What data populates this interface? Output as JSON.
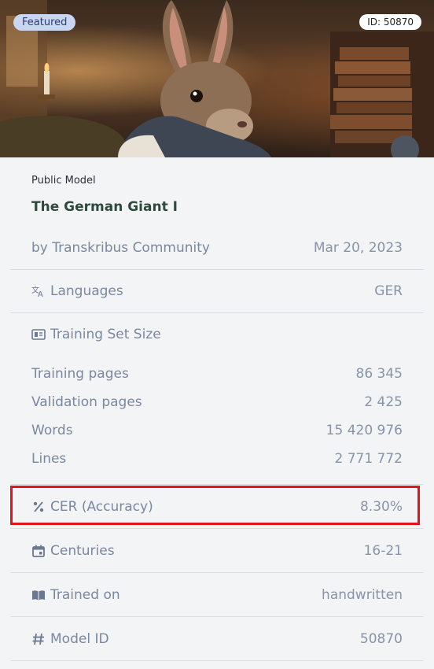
{
  "hero": {
    "featured_badge": "Featured",
    "id_badge": "ID: 50870"
  },
  "model": {
    "kind": "Public Model",
    "title": "The German Giant I",
    "author": "by Transkribus Community",
    "date": "Mar 20, 2023"
  },
  "details": {
    "languages_label": "Languages",
    "languages_value": "GER",
    "training_set_label": "Training Set Size",
    "training_pages_label": "Training pages",
    "training_pages_value": "86 345",
    "validation_pages_label": "Validation pages",
    "validation_pages_value": "2 425",
    "words_label": "Words",
    "words_value": "15 420 976",
    "lines_label": "Lines",
    "lines_value": "2 771 772",
    "cer_label": "CER (Accuracy)",
    "cer_value": "8.30%",
    "centuries_label": "Centuries",
    "centuries_value": "16-21",
    "trained_on_label": "Trained on",
    "trained_on_value": "handwritten",
    "model_id_label": "Model ID",
    "model_id_value": "50870"
  },
  "icons": [
    "translate-icon",
    "dataset-icon",
    "percent-icon",
    "calendar-icon",
    "book-icon",
    "hash-icon"
  ],
  "colors": {
    "highlight": "#e0141c",
    "featured_badge_bg": "#c9d6f2",
    "title": "#2e4a3c",
    "page_bg": "#f3f4f6"
  }
}
